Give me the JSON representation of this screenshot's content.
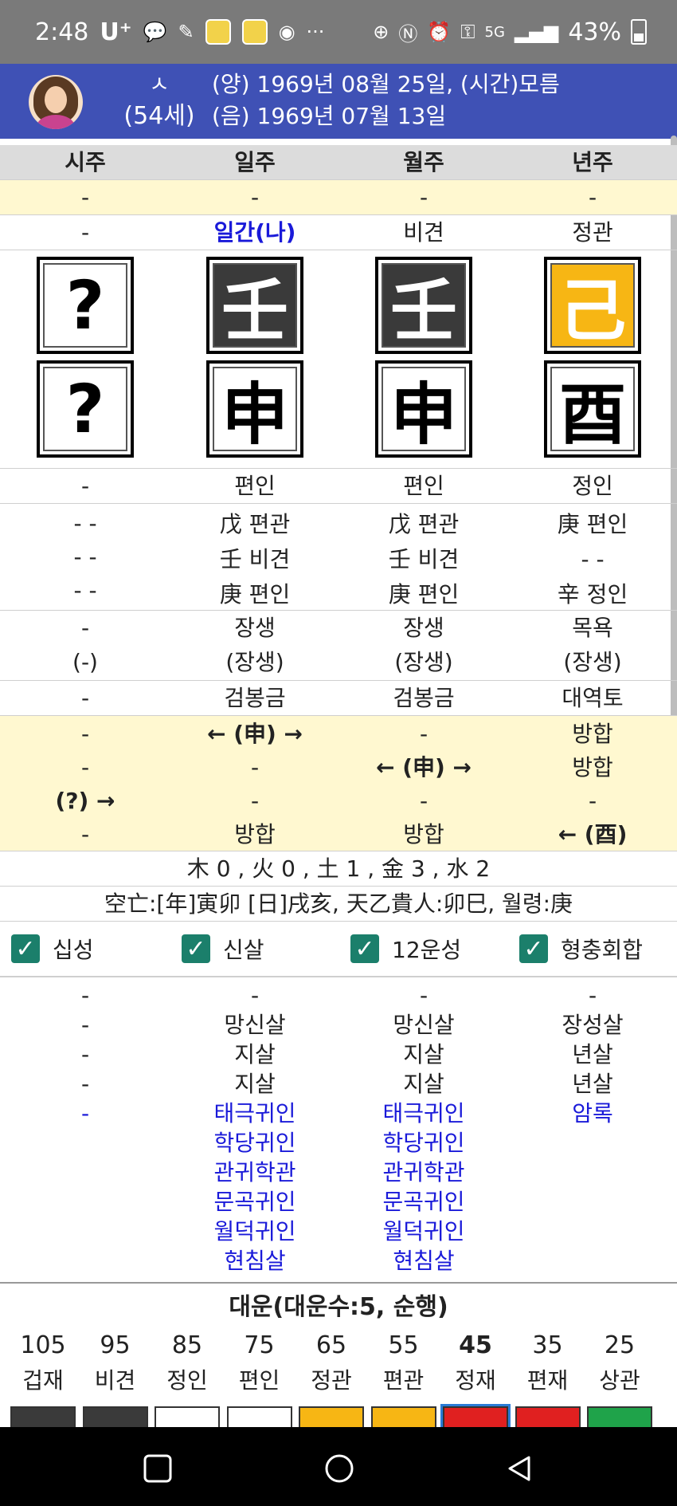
{
  "status": {
    "time": "2:48",
    "carrier": "U⁺",
    "battery": "43%",
    "network": "5G"
  },
  "profile": {
    "name": "ㅅ",
    "age": "(54세)",
    "solar": "(양) 1969년 08월 25일, (시간)모름",
    "lunar": "(음) 1969년 07월 13일"
  },
  "pillars": {
    "headers": [
      "시주",
      "일주",
      "월주",
      "년주"
    ],
    "row_top": [
      "-",
      "-",
      "-",
      "-"
    ],
    "sipsung_top": [
      "-",
      "일간(나)",
      "비견",
      "정관"
    ],
    "stems": [
      "?",
      "壬",
      "壬",
      "己"
    ],
    "branches": [
      "?",
      "申",
      "申",
      "酉"
    ],
    "sipsung_bottom": [
      "-",
      "편인",
      "편인",
      "정인"
    ],
    "hidden1": [
      "- -",
      "戊 편관",
      "戊 편관",
      "庚 편인"
    ],
    "hidden2": [
      "- -",
      "壬 비견",
      "壬 비견",
      "- -"
    ],
    "hidden3": [
      "- -",
      "庚 편인",
      "庚 편인",
      "辛 정인"
    ],
    "unsung1": [
      "-",
      "장생",
      "장생",
      "목욕"
    ],
    "unsung2": [
      "(-)",
      "(장생)",
      "(장생)",
      "(장생)"
    ],
    "napeum": [
      "-",
      "검봉금",
      "검봉금",
      "대역토"
    ],
    "rel1": [
      "-",
      "← (申) →",
      "-",
      "방합"
    ],
    "rel2": [
      "-",
      "-",
      "← (申) →",
      "방합"
    ],
    "rel3": [
      "(?) →",
      "-",
      "-",
      "-"
    ],
    "rel4": [
      "-",
      "방합",
      "방합",
      "← (酉)"
    ]
  },
  "elements": "木 0 , 火 0 , 土 1 , 金 3 , 水 2",
  "gongmang": "空亡:[年]寅卯 [日]戌亥, 天乙貴人:卯巳, 월령:庚",
  "options": [
    {
      "label": "십성",
      "checked": true
    },
    {
      "label": "신살",
      "checked": true
    },
    {
      "label": "12운성",
      "checked": true
    },
    {
      "label": "형충회합",
      "checked": true
    }
  ],
  "sinsal": {
    "r1": [
      "-",
      "-",
      "-",
      "-"
    ],
    "r2": [
      "-",
      "망신살",
      "망신살",
      "장성살"
    ],
    "r3": [
      "-",
      "지살",
      "지살",
      "년살"
    ],
    "r4": [
      "-",
      "지살",
      "지살",
      "년살"
    ],
    "blue": [
      [
        "-"
      ],
      [
        "태극귀인",
        "학당귀인",
        "관귀학관",
        "문곡귀인",
        "월덕귀인",
        "현침살"
      ],
      [
        "태극귀인",
        "학당귀인",
        "관귀학관",
        "문곡귀인",
        "월덕귀인",
        "현침살"
      ],
      [
        "암록"
      ]
    ]
  },
  "daewoon": {
    "title": "대운(대운수:5, 순행)",
    "items": [
      {
        "age": "105",
        "label": "겁재",
        "color": "#3a3a3a"
      },
      {
        "age": "95",
        "label": "비견",
        "color": "#3a3a3a"
      },
      {
        "age": "85",
        "label": "정인",
        "color": "#ffffff"
      },
      {
        "age": "75",
        "label": "편인",
        "color": "#ffffff"
      },
      {
        "age": "65",
        "label": "정관",
        "color": "#f7b614"
      },
      {
        "age": "55",
        "label": "편관",
        "color": "#f7b614"
      },
      {
        "age": "45",
        "label": "정재",
        "color": "#e02020",
        "current": true
      },
      {
        "age": "35",
        "label": "편재",
        "color": "#e02020"
      },
      {
        "age": "25",
        "label": "상관",
        "color": "#1fa34a"
      }
    ]
  },
  "colors": {
    "header_blue": "#3f51b5",
    "yellow_row": "#fff8d0",
    "checkbox": "#1b7f6b",
    "link_blue": "#1a1ad9"
  }
}
